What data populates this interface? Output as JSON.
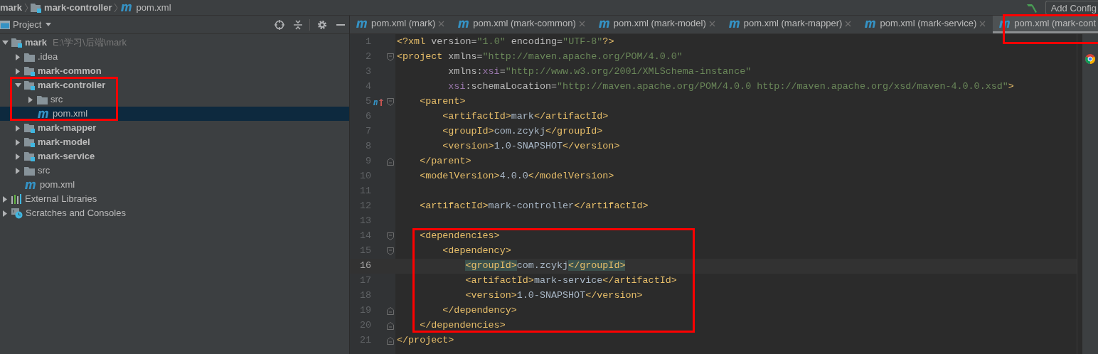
{
  "breadcrumbs": [
    {
      "label": "mark",
      "kind": "project"
    },
    {
      "label": "mark-controller",
      "kind": "module"
    },
    {
      "label": "pom.xml",
      "kind": "maven"
    }
  ],
  "toolbar": {
    "add_config_button": "Add Config"
  },
  "project_panel": {
    "title": "Project",
    "tree": [
      {
        "label": "mark",
        "kind": "module",
        "path": "E:\\学习\\后端\\mark",
        "expanded": true,
        "selected": false,
        "children": [
          {
            "label": ".idea",
            "kind": "folder",
            "expanded": false,
            "selected": false
          },
          {
            "label": "mark-common",
            "kind": "module",
            "expanded": false,
            "selected": false
          },
          {
            "label": "mark-controller",
            "kind": "module",
            "expanded": true,
            "selected": false,
            "children": [
              {
                "label": "src",
                "kind": "folder",
                "expanded": false,
                "selected": false
              },
              {
                "label": "pom.xml",
                "kind": "maven",
                "selected": true
              }
            ]
          },
          {
            "label": "mark-mapper",
            "kind": "module",
            "expanded": false,
            "selected": false
          },
          {
            "label": "mark-model",
            "kind": "module",
            "expanded": false,
            "selected": false
          },
          {
            "label": "mark-service",
            "kind": "module",
            "expanded": false,
            "selected": false
          },
          {
            "label": "src",
            "kind": "folder",
            "expanded": false,
            "selected": false
          },
          {
            "label": "pom.xml",
            "kind": "maven",
            "selected": false
          }
        ]
      },
      {
        "label": "External Libraries",
        "kind": "libraries",
        "expanded": false,
        "selected": false
      },
      {
        "label": "Scratches and Consoles",
        "kind": "scratches",
        "expanded": false,
        "selected": false
      }
    ]
  },
  "editor": {
    "tabs": [
      {
        "label": "pom.xml (mark)",
        "selected": false,
        "closable": true
      },
      {
        "label": "pom.xml (mark-common)",
        "selected": false,
        "closable": true
      },
      {
        "label": "pom.xml (mark-model)",
        "selected": false,
        "closable": true
      },
      {
        "label": "pom.xml (mark-mapper)",
        "selected": false,
        "closable": true
      },
      {
        "label": "pom.xml (mark-service)",
        "selected": false,
        "closable": true
      },
      {
        "label": "pom.xml (mark-cont",
        "selected": true,
        "closable": false
      }
    ],
    "lines": [
      {
        "number": "1",
        "current": false,
        "tokens": [
          {
            "kind": "tag",
            "text": "<?xml"
          },
          {
            "kind": "attr",
            "text": " version="
          },
          {
            "kind": "value",
            "text": "\"1.0\""
          },
          {
            "kind": "attr",
            "text": " encoding="
          },
          {
            "kind": "value",
            "text": "\"UTF-8\""
          },
          {
            "kind": "tag",
            "text": "?>"
          }
        ]
      },
      {
        "number": "2",
        "current": false,
        "gutter_icons": [
          {
            "kind": "fold-start"
          }
        ],
        "tokens": [
          {
            "kind": "tag",
            "text": "<project"
          },
          {
            "kind": "attr",
            "text": " xmlns="
          },
          {
            "kind": "value",
            "text": "\"http://maven.apache.org/POM/4.0.0\""
          }
        ]
      },
      {
        "number": "3",
        "current": false,
        "tokens": [
          {
            "kind": "attr",
            "text": "         xmlns:"
          },
          {
            "kind": "ns",
            "text": "xsi"
          },
          {
            "kind": "attr",
            "text": "="
          },
          {
            "kind": "value",
            "text": "\"http://www.w3.org/2001/XMLSchema-instance\""
          }
        ]
      },
      {
        "number": "4",
        "current": false,
        "tokens": [
          {
            "kind": "ns",
            "text": "         xsi"
          },
          {
            "kind": "attr",
            "text": ":schemaLocation="
          },
          {
            "kind": "value",
            "text": "\"http://maven.apache.org/POM/4.0.0 http://maven.apache.org/xsd/maven-4.0.0.xsd\""
          },
          {
            "kind": "tag",
            "text": ">"
          }
        ]
      },
      {
        "number": "5",
        "current": false,
        "gutter_icons": [
          {
            "kind": "maven-parent"
          },
          {
            "kind": "fold-start"
          }
        ],
        "tokens": [
          {
            "kind": "tag",
            "text": "    <parent>"
          }
        ]
      },
      {
        "number": "6",
        "current": false,
        "tokens": [
          {
            "kind": "tag",
            "text": "        <artifactId>"
          },
          {
            "kind": "text",
            "text": "mark"
          },
          {
            "kind": "tag",
            "text": "</artifactId>"
          }
        ]
      },
      {
        "number": "7",
        "current": false,
        "tokens": [
          {
            "kind": "tag",
            "text": "        <groupId>"
          },
          {
            "kind": "text",
            "text": "com.zcykj"
          },
          {
            "kind": "tag",
            "text": "</groupId>"
          }
        ]
      },
      {
        "number": "8",
        "current": false,
        "tokens": [
          {
            "kind": "tag",
            "text": "        <version>"
          },
          {
            "kind": "text",
            "text": "1.0-SNAPSHOT"
          },
          {
            "kind": "tag",
            "text": "</version>"
          }
        ]
      },
      {
        "number": "9",
        "current": false,
        "gutter_icons": [
          {
            "kind": "fold-end"
          }
        ],
        "tokens": [
          {
            "kind": "tag",
            "text": "    </parent>"
          }
        ]
      },
      {
        "number": "10",
        "current": false,
        "tokens": [
          {
            "kind": "tag",
            "text": "    <modelVersion>"
          },
          {
            "kind": "text",
            "text": "4.0.0"
          },
          {
            "kind": "tag",
            "text": "</modelVersion>"
          }
        ]
      },
      {
        "number": "11",
        "current": false
      },
      {
        "number": "12",
        "current": false,
        "tokens": [
          {
            "kind": "tag",
            "text": "    <artifactId>"
          },
          {
            "kind": "text",
            "text": "mark-controller"
          },
          {
            "kind": "tag",
            "text": "</artifactId>"
          }
        ]
      },
      {
        "number": "13",
        "current": false
      },
      {
        "number": "14",
        "current": false,
        "gutter_icons": [
          {
            "kind": "fold-start"
          }
        ],
        "tokens": [
          {
            "kind": "tag",
            "text": "    <dependencies>"
          }
        ]
      },
      {
        "number": "15",
        "current": false,
        "gutter_icons": [
          {
            "kind": "fold-start"
          }
        ],
        "tokens": [
          {
            "kind": "tag",
            "text": "        <dependency>"
          }
        ]
      },
      {
        "number": "16",
        "current": true,
        "tokens": [
          {
            "kind": "match",
            "text": "            <groupId>"
          },
          {
            "kind": "text",
            "text": "com.zcykj"
          },
          {
            "kind": "match",
            "text": "</groupId>"
          }
        ]
      },
      {
        "number": "17",
        "current": false,
        "tokens": [
          {
            "kind": "tag",
            "text": "            <artifactId>"
          },
          {
            "kind": "text",
            "text": "mark-service"
          },
          {
            "kind": "tag",
            "text": "</artifactId>"
          }
        ]
      },
      {
        "number": "18",
        "current": false,
        "tokens": [
          {
            "kind": "tag",
            "text": "            <version>"
          },
          {
            "kind": "text",
            "text": "1.0-SNAPSHOT"
          },
          {
            "kind": "tag",
            "text": "</version>"
          }
        ]
      },
      {
        "number": "19",
        "current": false,
        "gutter_icons": [
          {
            "kind": "fold-end"
          }
        ],
        "tokens": [
          {
            "kind": "tag",
            "text": "        </dependency>"
          }
        ]
      },
      {
        "number": "20",
        "current": false,
        "gutter_icons": [
          {
            "kind": "fold-end"
          }
        ],
        "tokens": [
          {
            "kind": "tag",
            "text": "    </dependencies>"
          }
        ]
      },
      {
        "number": "21",
        "current": false,
        "gutter_icons": [
          {
            "kind": "fold-end"
          }
        ],
        "tokens": [
          {
            "kind": "tag",
            "text": "</project>"
          }
        ]
      }
    ]
  }
}
